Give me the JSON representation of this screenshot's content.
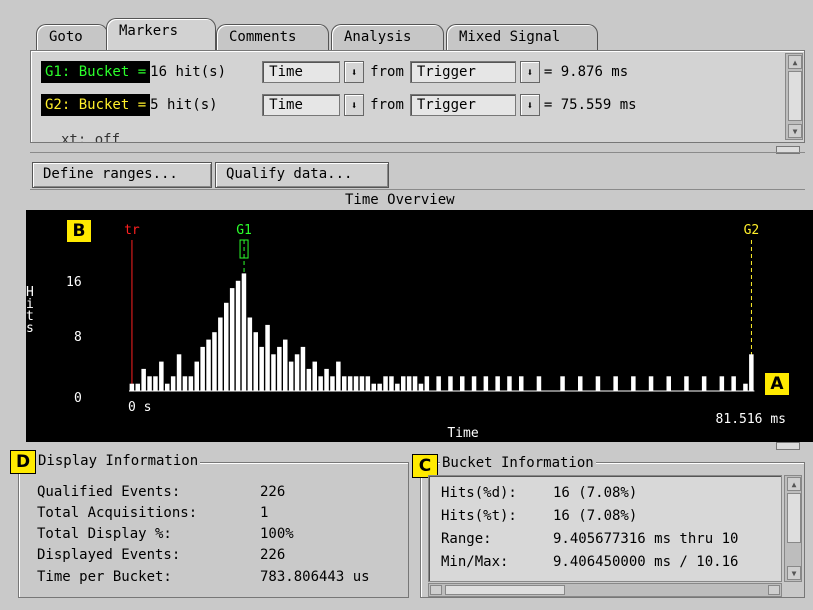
{
  "tabs": [
    {
      "label": "Goto",
      "active": false
    },
    {
      "label": "Markers",
      "active": true
    },
    {
      "label": "Comments",
      "active": false
    },
    {
      "label": "Analysis",
      "active": false
    },
    {
      "label": "Mixed Signal",
      "active": false
    }
  ],
  "markers": {
    "g1": {
      "name": "G1: Bucket =",
      "hits": "16 hit(s)",
      "mode": "Time",
      "from_label": "from",
      "ref": "Trigger",
      "value": "= 9.876 ms"
    },
    "g2": {
      "name": "G2: Bucket =",
      "hits": "5 hit(s)",
      "mode": "Time",
      "from_label": "from",
      "ref": "Trigger",
      "value": "= 75.559 ms"
    },
    "partial_row": "xt: off"
  },
  "buttons": {
    "define_ranges": "Define ranges...",
    "qualify_data": "Qualify data..."
  },
  "chart_title": "Time Overview",
  "chart_data": {
    "type": "bar",
    "title": "Time Overview",
    "xlabel": "Time",
    "ylabel": "Hits",
    "ylim": [
      0,
      16
    ],
    "y_ticks": [
      "0",
      "8",
      "16"
    ],
    "x_start_label": "0 s",
    "x_end_label": "81.516 ms",
    "bucket_width": "783.806443 us",
    "values": [
      1,
      1,
      3,
      2,
      2,
      4,
      1,
      2,
      5,
      2,
      2,
      4,
      6,
      7,
      8,
      10,
      12,
      14,
      15,
      16,
      10,
      8,
      6,
      9,
      5,
      6,
      7,
      4,
      5,
      6,
      3,
      4,
      2,
      3,
      2,
      4,
      2,
      2,
      2,
      2,
      2,
      1,
      1,
      2,
      2,
      1,
      2,
      2,
      2,
      1,
      2,
      0,
      2,
      0,
      2,
      0,
      2,
      0,
      2,
      0,
      2,
      0,
      2,
      0,
      2,
      0,
      2,
      0,
      0,
      2,
      0,
      0,
      0,
      2,
      0,
      0,
      2,
      0,
      0,
      2,
      0,
      0,
      2,
      0,
      0,
      2,
      0,
      0,
      2,
      0,
      0,
      2,
      0,
      0,
      2,
      0,
      0,
      2,
      0,
      0,
      2,
      0,
      2,
      0,
      1,
      5
    ],
    "markers": [
      {
        "label": "tr",
        "color": "#ff2020",
        "bucket": 0
      },
      {
        "label": "G1",
        "color": "#2bff2b",
        "bucket": 19
      },
      {
        "label": "G2",
        "color": "#ffef2b",
        "bucket": 105
      }
    ],
    "colors": {
      "background": "#000000",
      "bars": "#ffffff",
      "text": "#ffffff"
    }
  },
  "callouts": {
    "a": "A",
    "b": "B",
    "c": "C",
    "d": "D"
  },
  "display_info": {
    "title": "Display Information",
    "rows": [
      {
        "label": "Qualified Events:",
        "value": "226"
      },
      {
        "label": "Total Acquisitions:",
        "value": "1"
      },
      {
        "label": "Total Display %:",
        "value": "100%"
      },
      {
        "label": "Displayed Events:",
        "value": "226"
      },
      {
        "label": "Time per Bucket:",
        "value": "783.806443 us"
      }
    ]
  },
  "bucket_info": {
    "title": "Bucket Information",
    "rows": [
      {
        "label": "Hits(%d):",
        "value": "16 (7.08%)"
      },
      {
        "label": "Hits(%t):",
        "value": "16 (7.08%)"
      },
      {
        "label": "Range:",
        "value": "9.405677316 ms thru 10"
      },
      {
        "label": "Min/Max:",
        "value": "9.406450000 ms / 10.16"
      }
    ]
  }
}
